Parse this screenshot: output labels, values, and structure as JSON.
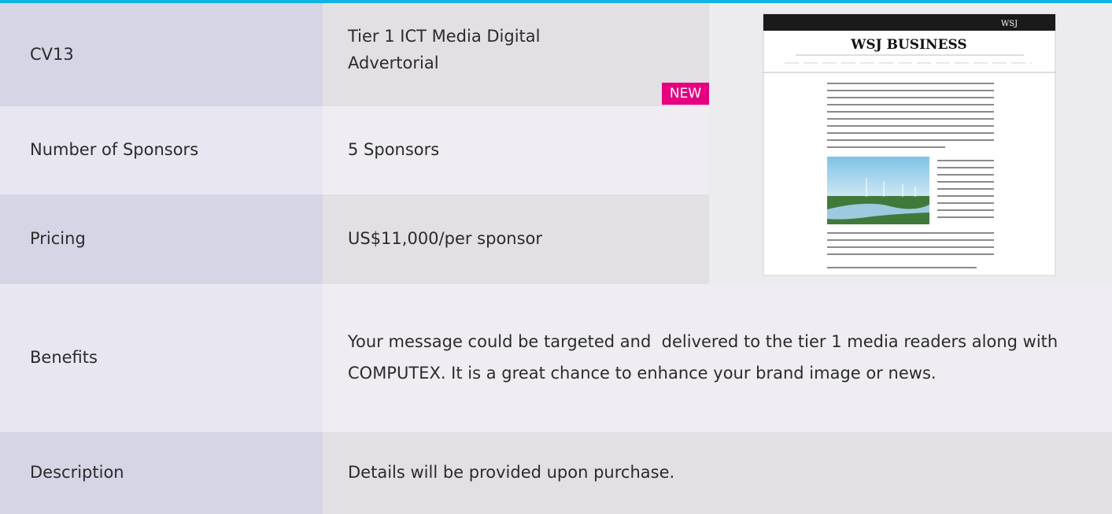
{
  "rows": {
    "code": {
      "label": "CV13",
      "value": "Tier 1 ICT Media Digital Advertorial",
      "badge": "NEW"
    },
    "sponsors": {
      "label": "Number of Sponsors",
      "value": "5 Sponsors"
    },
    "pricing": {
      "label": "Pricing",
      "value": "US$11,000/per sponsor"
    },
    "benefits": {
      "label": "Benefits",
      "value": "Your message could be targeted and  delivered to the tier 1 media readers along with COMPUTEX. It is a great chance to enhance your brand image or news."
    },
    "description": {
      "label": "Description",
      "value": "Details will be provided upon purchase."
    }
  },
  "preview": {
    "masthead": "WSJ  BUSINESS",
    "brand": "WSJ"
  },
  "colors": {
    "accent_bar": "#12b3e4",
    "badge": "#e5007f",
    "label_bg": "#d6d5e6",
    "value_bg": "#e3e0e4"
  }
}
